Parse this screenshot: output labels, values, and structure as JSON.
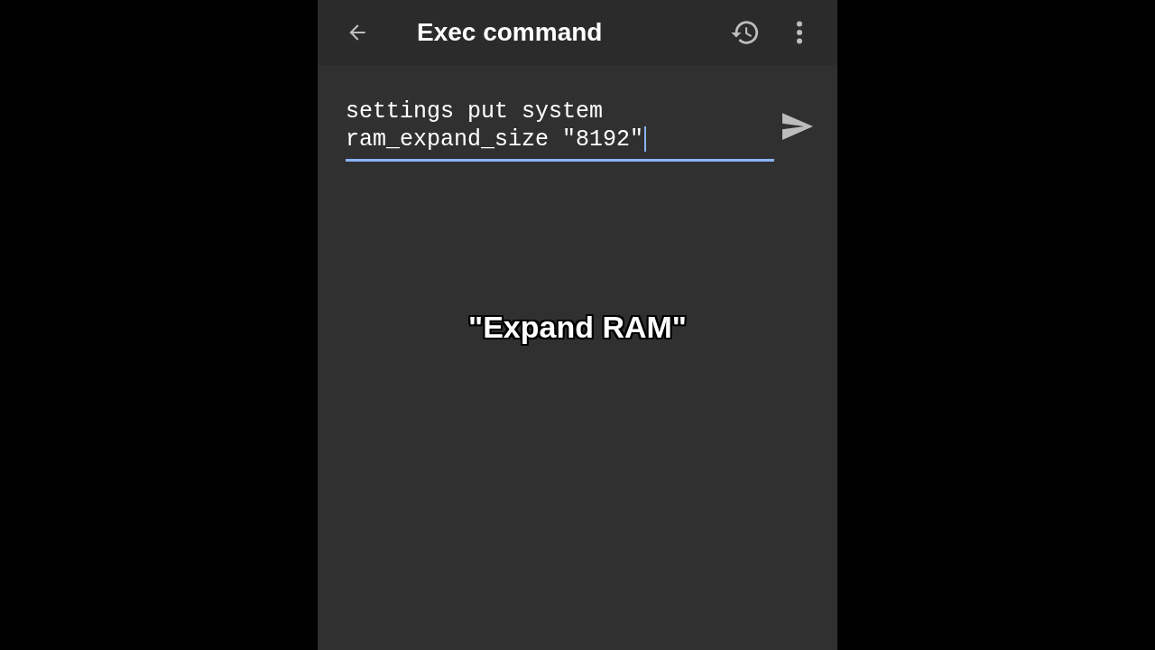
{
  "app_bar": {
    "title": "Exec command"
  },
  "command_field": {
    "value": "settings put system ram_expand_size \"8192\"",
    "focused": true
  },
  "caption": "\"Expand RAM\""
}
